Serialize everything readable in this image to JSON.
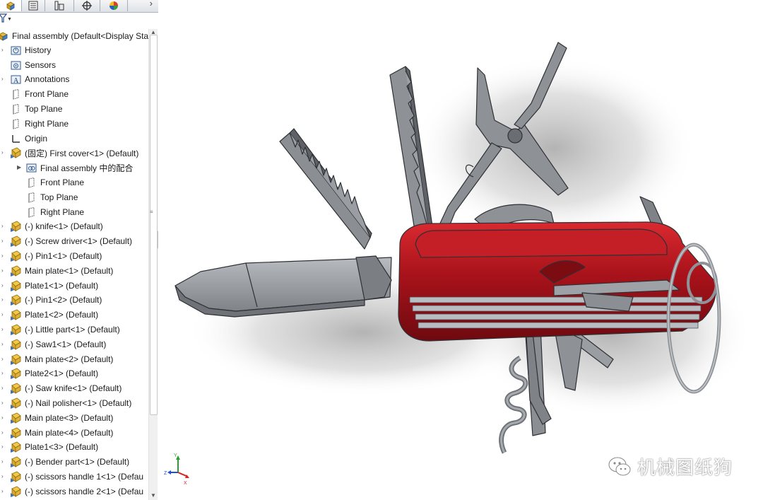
{
  "feature_tree": {
    "root_label": "Final assembly  (Default<Display Sta",
    "nodes": [
      {
        "label": "History",
        "icon": "history-icon"
      },
      {
        "label": "Sensors",
        "icon": "sensors-icon"
      },
      {
        "label": "Annotations",
        "icon": "annotations-icon"
      },
      {
        "label": "Front Plane",
        "icon": "plane-icon"
      },
      {
        "label": "Top Plane",
        "icon": "plane-icon"
      },
      {
        "label": "Right Plane",
        "icon": "plane-icon"
      },
      {
        "label": "Origin",
        "icon": "origin-icon"
      },
      {
        "label": "(固定) First cover<1> (Default)",
        "icon": "part-icon"
      },
      {
        "label": "Final assembly 中的配合",
        "icon": "mates-icon"
      },
      {
        "label": "Front Plane",
        "icon": "plane-icon"
      },
      {
        "label": "Top Plane",
        "icon": "plane-icon"
      },
      {
        "label": "Right Plane",
        "icon": "plane-icon"
      },
      {
        "label": "(-) knife<1> (Default)",
        "icon": "part-icon"
      },
      {
        "label": "(-) Screw driver<1> (Default)",
        "icon": "part-icon"
      },
      {
        "label": "(-) Pin1<1> (Default)",
        "icon": "part-icon"
      },
      {
        "label": "Main plate<1> (Default)",
        "icon": "part-icon"
      },
      {
        "label": "Plate1<1> (Default)",
        "icon": "part-icon"
      },
      {
        "label": "(-) Pin1<2> (Default)",
        "icon": "part-icon"
      },
      {
        "label": "Plate1<2> (Default)",
        "icon": "part-icon"
      },
      {
        "label": "(-) Little part<1> (Default)",
        "icon": "part-icon"
      },
      {
        "label": "(-) Saw1<1> (Default)",
        "icon": "part-icon"
      },
      {
        "label": "Main plate<2> (Default)",
        "icon": "part-icon"
      },
      {
        "label": "Plate2<1> (Default)",
        "icon": "part-icon"
      },
      {
        "label": "(-) Saw knife<1> (Default)",
        "icon": "part-icon"
      },
      {
        "label": "(-) Nail polisher<1> (Default)",
        "icon": "part-icon"
      },
      {
        "label": "Main plate<3> (Default)",
        "icon": "part-icon"
      },
      {
        "label": "Main plate<4> (Default)",
        "icon": "part-icon"
      },
      {
        "label": "Plate1<3> (Default)",
        "icon": "part-icon"
      },
      {
        "label": "(-) Bender part<1> (Default)",
        "icon": "part-icon"
      },
      {
        "label": "(-) scissors handle 1<1> (Defau",
        "icon": "part-icon"
      },
      {
        "label": "(-) scissors handle 2<1> (Defau",
        "icon": "part-icon"
      }
    ]
  },
  "tabs": [
    {
      "icon": "feature-manager-icon"
    },
    {
      "icon": "property-manager-icon"
    },
    {
      "icon": "configuration-manager-icon"
    },
    {
      "icon": "dimxpert-icon"
    },
    {
      "icon": "display-manager-icon"
    }
  ],
  "triad": {
    "y": "Y",
    "x": "X",
    "z": "Z"
  },
  "watermark": {
    "text": "机械图纸狗",
    "icon": "wechat-icon"
  },
  "colors": {
    "handle_red": "#a01018",
    "steel": "#8f9398",
    "part_icon": "#e3b52a"
  }
}
